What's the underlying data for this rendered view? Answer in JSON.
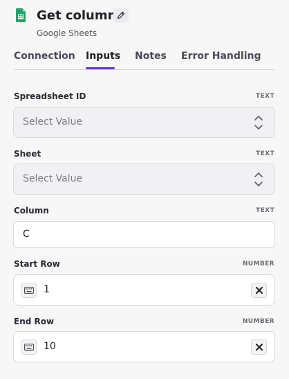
{
  "header": {
    "title": "Get column",
    "subtitle": "Google Sheets",
    "app_icon": "google-sheets-icon",
    "edit_icon": "pencil-icon"
  },
  "tabs": [
    {
      "label": "Connection",
      "active": false
    },
    {
      "label": "Inputs",
      "active": true
    },
    {
      "label": "Notes",
      "active": false
    },
    {
      "label": "Error Handling",
      "active": false
    }
  ],
  "fields": {
    "spreadsheet_id": {
      "label": "Spreadsheet ID",
      "type": "TEXT",
      "placeholder": "Select Value"
    },
    "sheet": {
      "label": "Sheet",
      "type": "TEXT",
      "placeholder": "Select Value"
    },
    "column": {
      "label": "Column",
      "type": "TEXT",
      "value": "C"
    },
    "start_row": {
      "label": "Start Row",
      "type": "NUMBER",
      "value": "1"
    },
    "end_row": {
      "label": "End Row",
      "type": "NUMBER",
      "value": "10"
    }
  },
  "colors": {
    "accent": "#6b2fd8",
    "sheets_green": "#21a464",
    "background": "#f7f7f8"
  }
}
